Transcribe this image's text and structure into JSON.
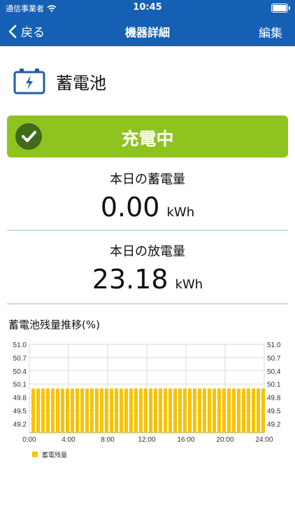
{
  "status_bar": {
    "carrier": "通信事業者",
    "time": "10:45"
  },
  "nav": {
    "back_label": "戻る",
    "title": "機器詳細",
    "edit_label": "編集"
  },
  "device": {
    "name": "蓄電池"
  },
  "state": {
    "label": "充電中",
    "color": "#8fc31f"
  },
  "metrics": [
    {
      "label": "本日の蓄電量",
      "value": "0.00",
      "unit": "kWh"
    },
    {
      "label": "本日の放電量",
      "value": "23.18",
      "unit": "kWh"
    }
  ],
  "chart_title": "蓄電池残量推移(%)",
  "chart_data": {
    "type": "bar",
    "y_ticks": [
      "51.0",
      "50.7",
      "50.4",
      "50.1",
      "49.8",
      "49.5",
      "49.2"
    ],
    "ylim": [
      49.0,
      51.0
    ],
    "x_ticks": [
      "0:00",
      "4:00",
      "8:00",
      "12:00",
      "16:00",
      "20:00",
      "24:00"
    ],
    "series": [
      {
        "name": "蓄電残量",
        "color": "#f7c300",
        "values": [
          50,
          50,
          50,
          50,
          50,
          50,
          50,
          50,
          50,
          50,
          50,
          50,
          50,
          50,
          50,
          50,
          50,
          50,
          50,
          50,
          50,
          50,
          50,
          50,
          50,
          50,
          50,
          50,
          50,
          50,
          50,
          50,
          50,
          50,
          50,
          50,
          50,
          50,
          50,
          50,
          50,
          50,
          50,
          50,
          50,
          50,
          50,
          50
        ]
      }
    ]
  }
}
